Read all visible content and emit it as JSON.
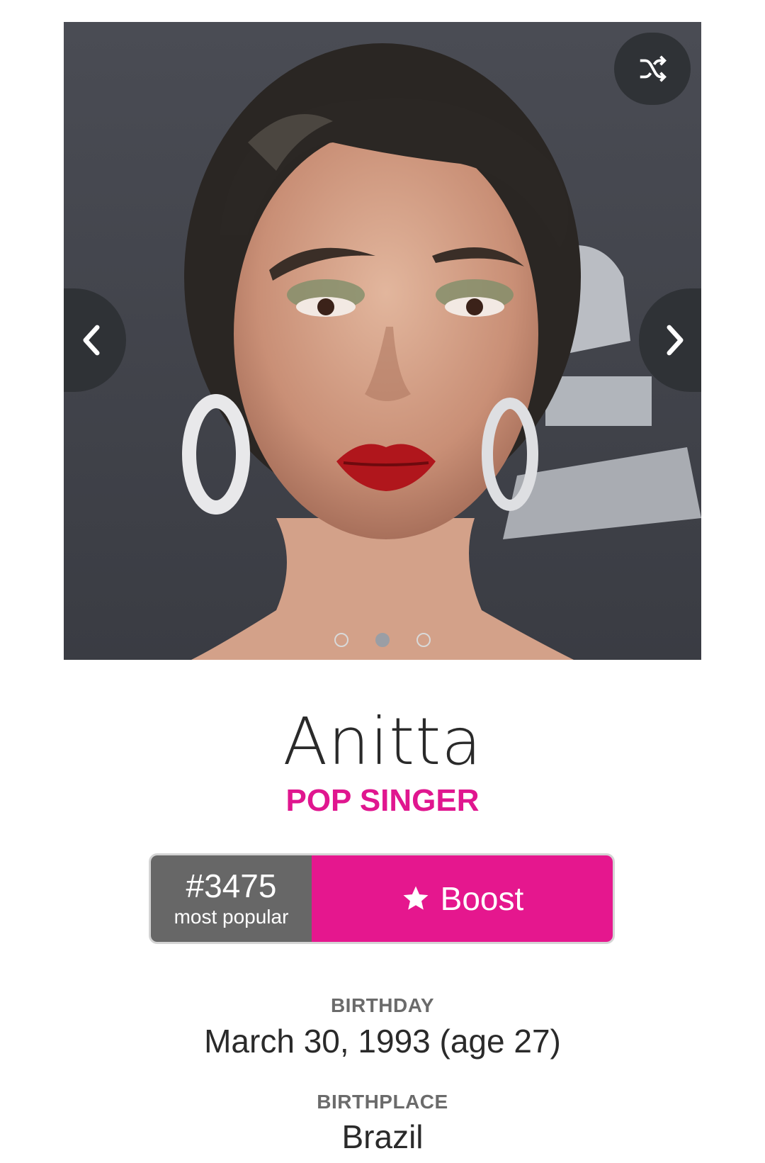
{
  "profile": {
    "name": "Anitta",
    "occupation": "POP SINGER"
  },
  "carousel": {
    "photo_icon": "portrait-photo",
    "shuffle_icon": "shuffle-icon",
    "prev_icon": "chevron-left-icon",
    "next_icon": "chevron-right-icon",
    "dot_count": 3,
    "active_dot": 2
  },
  "rank": {
    "number": "#3475",
    "label": "most popular"
  },
  "boost": {
    "label": "Boost",
    "icon": "star-icon"
  },
  "facts": {
    "birthday_label": "BIRTHDAY",
    "birthday_value": "March 30, 1993 (age 27)",
    "birthplace_label": "BIRTHPLACE",
    "birthplace_value": "Brazil"
  },
  "colors": {
    "accent": "#e5178e",
    "rank_bg": "#676767",
    "button_bg": "#2f3236"
  }
}
